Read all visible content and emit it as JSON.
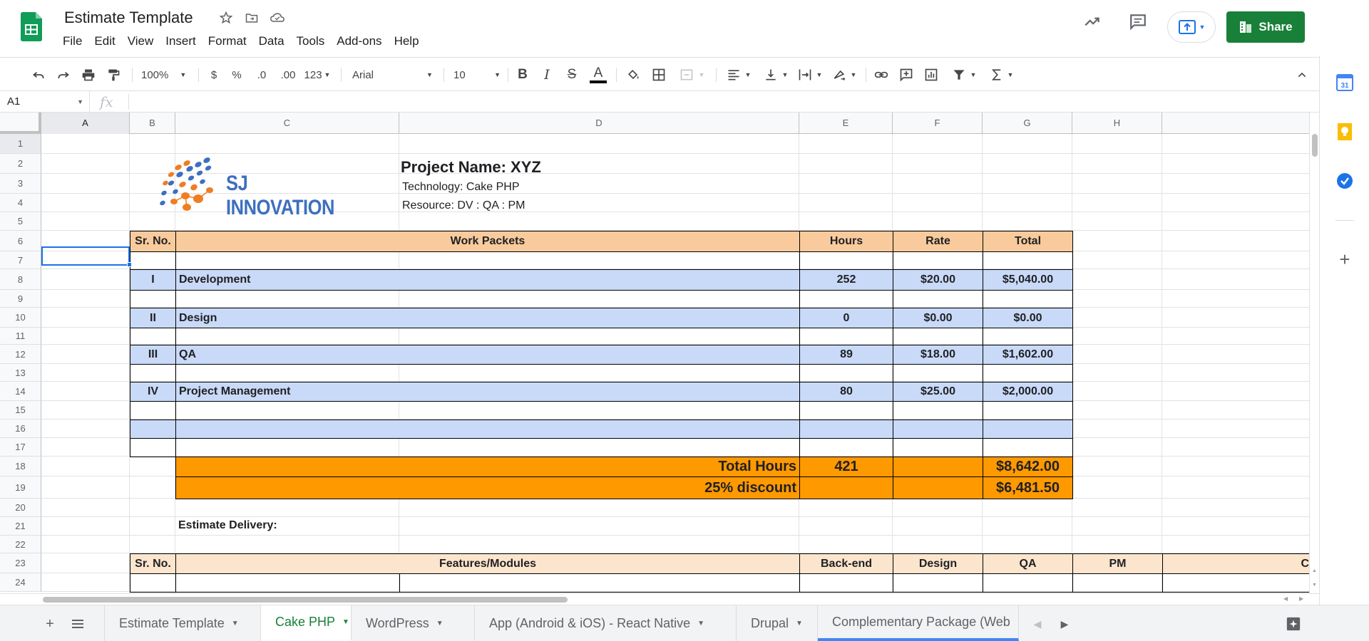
{
  "header": {
    "title": "Estimate Template",
    "menu": [
      "File",
      "Edit",
      "View",
      "Insert",
      "Format",
      "Data",
      "Tools",
      "Add-ons",
      "Help"
    ],
    "share_label": "Share"
  },
  "toolbar": {
    "zoom": "100%",
    "currency": "$",
    "percent": "%",
    "dec_less": ".0",
    "dec_more": ".00",
    "more_formats": "123",
    "font": "Arial",
    "font_size": "10",
    "bold": "B",
    "italic": "I",
    "strike": "S",
    "text_color": "A"
  },
  "formula_bar": {
    "name_box": "A1",
    "fx": "fx"
  },
  "columns": [
    "A",
    "B",
    "C",
    "D",
    "E",
    "F",
    "G",
    "H"
  ],
  "rows": [
    "1",
    "2",
    "3",
    "4",
    "5",
    "6",
    "7",
    "8",
    "9",
    "10",
    "11",
    "12",
    "13",
    "14",
    "15",
    "16",
    "17",
    "18",
    "19",
    "20",
    "21",
    "22",
    "23",
    "24"
  ],
  "logo": {
    "text": "SJ INNOVATION"
  },
  "project": {
    "name": "Project Name: XYZ",
    "technology": "Technology: Cake PHP",
    "resource": "Resource: DV : QA : PM"
  },
  "table1": {
    "headers": [
      "Sr. No.",
      "Work Packets",
      "Hours",
      "Rate",
      "Total"
    ],
    "rows": [
      {
        "sr": "I",
        "packet": "Development",
        "hours": "252",
        "rate": "$20.00",
        "total": "$5,040.00"
      },
      {
        "sr": "II",
        "packet": "Design",
        "hours": "0",
        "rate": "$0.00",
        "total": "$0.00"
      },
      {
        "sr": "III",
        "packet": "QA",
        "hours": "89",
        "rate": "$18.00",
        "total": "$1,602.00"
      },
      {
        "sr": "IV",
        "packet": "Project Management",
        "hours": "80",
        "rate": "$25.00",
        "total": "$2,000.00"
      }
    ],
    "total_label": "Total Hours",
    "total_hours": "421",
    "total_amount": "$8,642.00",
    "discount_label": "25% discount",
    "discount_amount": "$6,481.50"
  },
  "delivery_label": "Estimate Delivery:",
  "table2": {
    "headers": [
      "Sr. No.",
      "Features/Modules",
      "Back-end",
      "Design",
      "QA",
      "PM",
      "C"
    ]
  },
  "tabs": [
    "Estimate Template",
    "Cake PHP",
    "WordPress",
    "App (Android & iOS) - React Native",
    "Drupal",
    "Complementary Package (Web"
  ],
  "colors": {
    "header_fill": "#f9cb9c",
    "row_fill": "#c9daf8",
    "total_fill": "#ff9900",
    "share_green": "#188038",
    "selection": "#1a73e8"
  }
}
